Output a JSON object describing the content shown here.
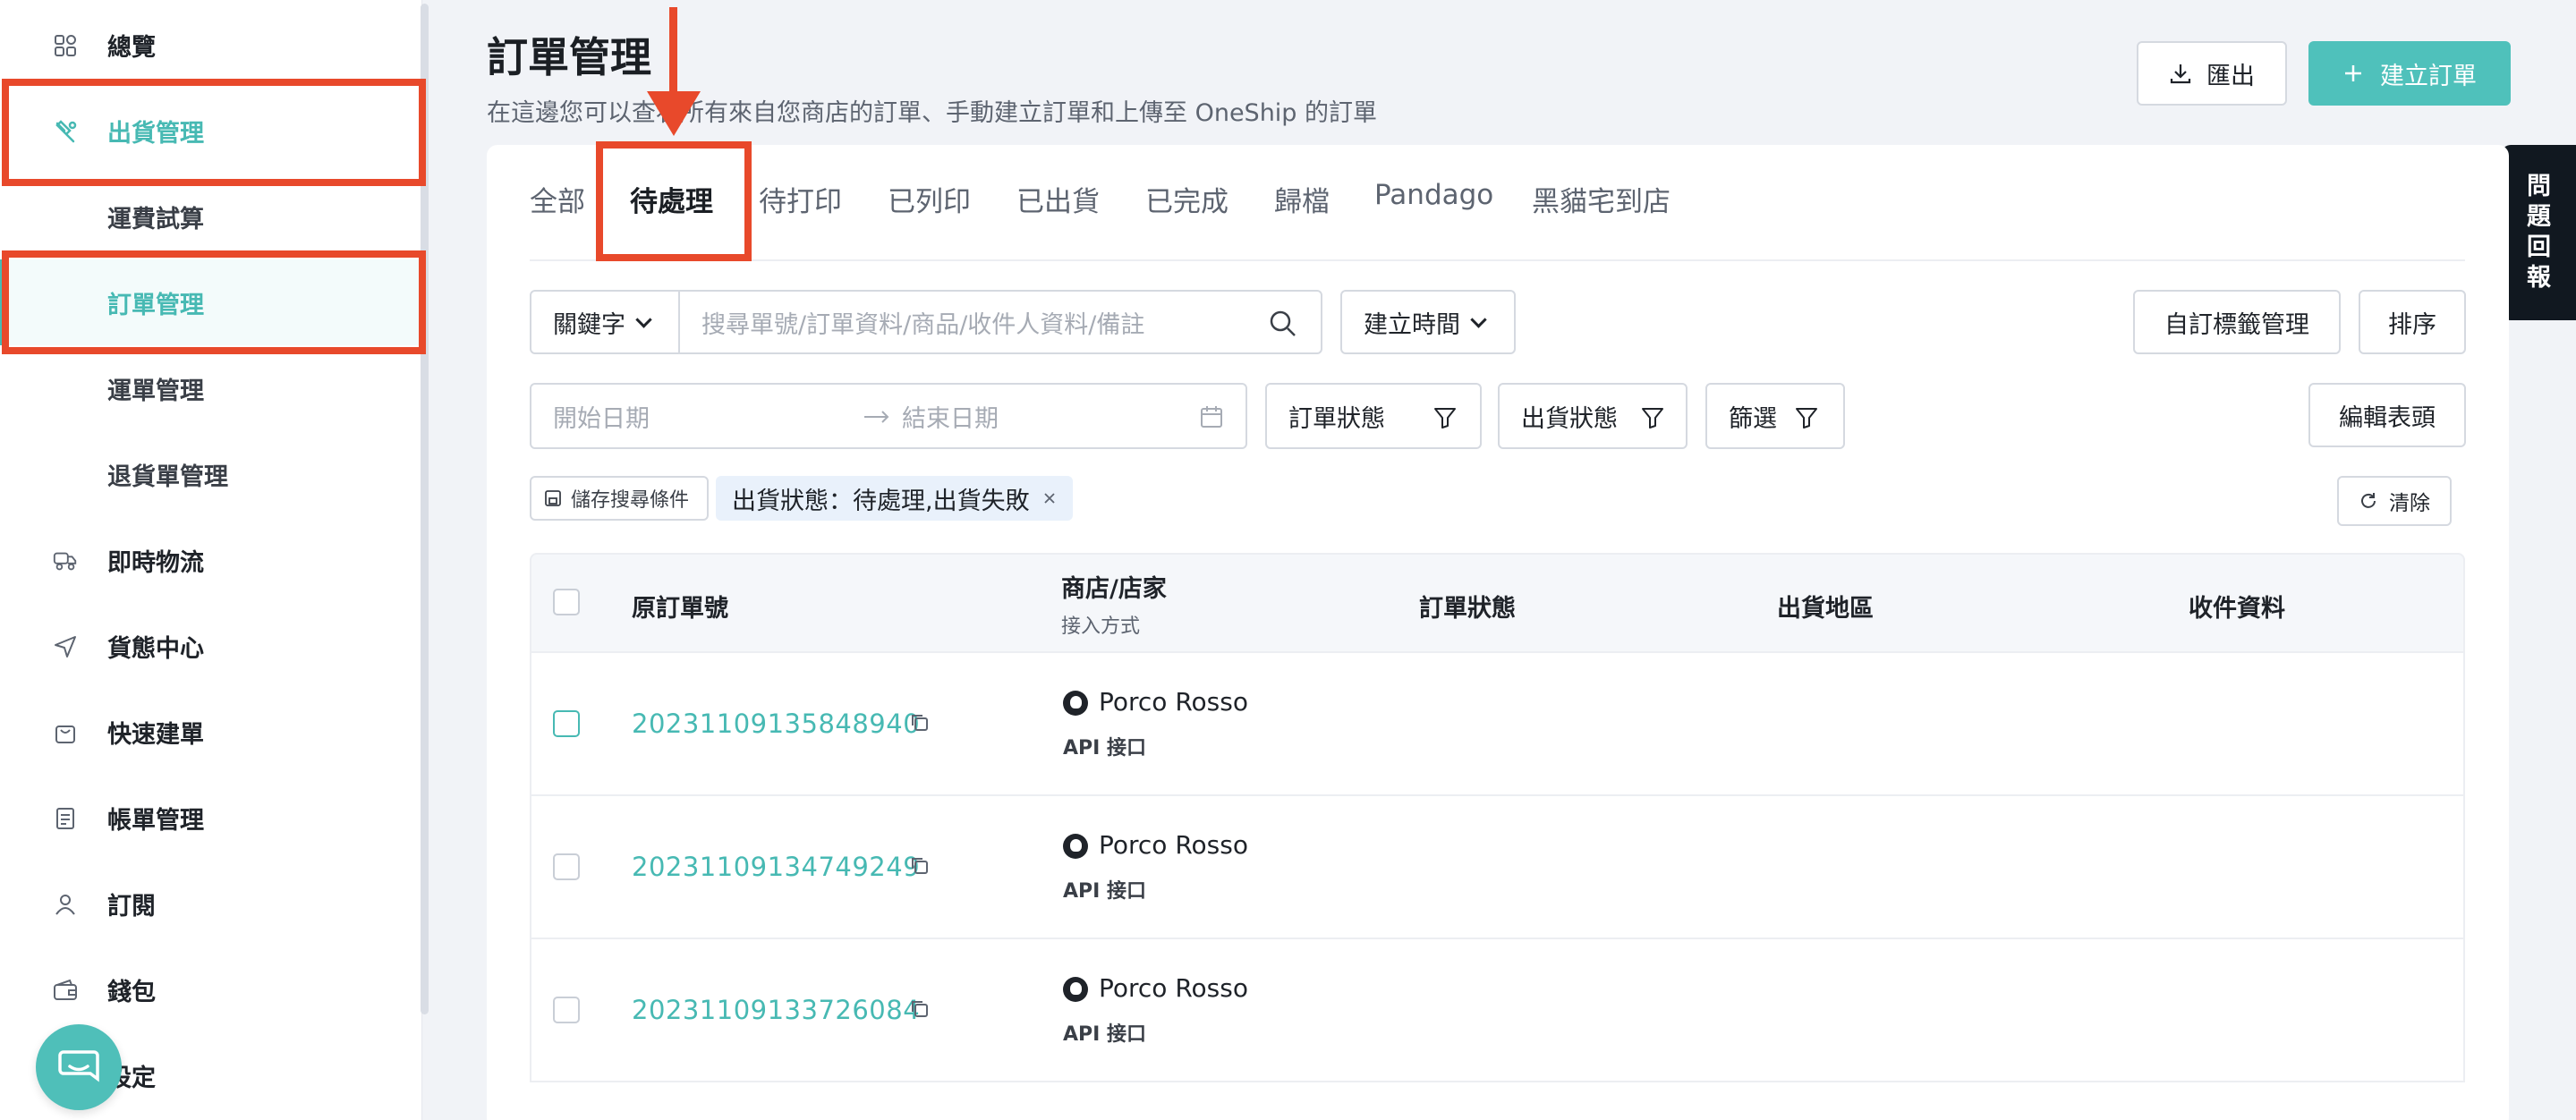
{
  "sidebar": {
    "items": [
      {
        "label": "總覽",
        "icon": "grid-icon"
      },
      {
        "label": "出貨管理",
        "icon": "shipping-icon"
      },
      {
        "label": "運費試算"
      },
      {
        "label": "訂單管理"
      },
      {
        "label": "運單管理"
      },
      {
        "label": "退貨單管理"
      },
      {
        "label": "即時物流",
        "icon": "delivery-icon"
      },
      {
        "label": "貨態中心",
        "icon": "send-icon"
      },
      {
        "label": "快速建單",
        "icon": "bag-icon"
      },
      {
        "label": "帳單管理",
        "icon": "bill-icon"
      },
      {
        "label": "訂閱",
        "icon": "user-icon"
      },
      {
        "label": "錢包",
        "icon": "wallet-icon"
      },
      {
        "label": "設定",
        "icon": "gear-icon"
      }
    ]
  },
  "header": {
    "title": "訂單管理",
    "subtitle": "在這邊您可以查看所有來自您商店的訂單、手動建立訂單和上傳至 OneShip 的訂單",
    "export_label": "匯出",
    "create_label": "建立訂單",
    "feedback_chars": [
      "問",
      "題",
      "回",
      "報"
    ]
  },
  "tabs": [
    "全部",
    "待處理",
    "待打印",
    "已列印",
    "已出貨",
    "已完成",
    "歸檔",
    "Pandago",
    "黑貓宅到店"
  ],
  "filters": {
    "keyword_label": "關鍵字",
    "search_placeholder": "搜尋單號/訂單資料/商品/收件人資料/備註",
    "created_time_label": "建立時間",
    "custom_tag_label": "自訂標籤管理",
    "sort_label": "排序",
    "start_date_placeholder": "開始日期",
    "end_date_placeholder": "結束日期",
    "order_status_label": "訂單狀態",
    "shipping_status_label": "出貨狀態",
    "filter_label": "篩選",
    "edit_header_label": "編輯表頭",
    "save_search_label": "儲存搜尋條件",
    "active_chip": "出貨狀態：待處理,出貨失敗",
    "clear_label": "清除"
  },
  "table": {
    "columns": {
      "order_no": "原訂單號",
      "store": "商店/店家",
      "store_sub": "接入方式",
      "order_status": "訂單狀態",
      "ship_region": "出貨地區",
      "recipient": "收件資料"
    },
    "rows": [
      {
        "order_no": "20231109135848940",
        "store": "Porco Rosso",
        "channel": "API 接口"
      },
      {
        "order_no": "20231109134749249",
        "store": "Porco Rosso",
        "channel": "API 接口"
      },
      {
        "order_no": "20231109133726084",
        "store": "Porco Rosso",
        "channel": "API 接口"
      }
    ]
  },
  "colors": {
    "accent": "#47b9b3",
    "highlight": "#e8492b"
  }
}
